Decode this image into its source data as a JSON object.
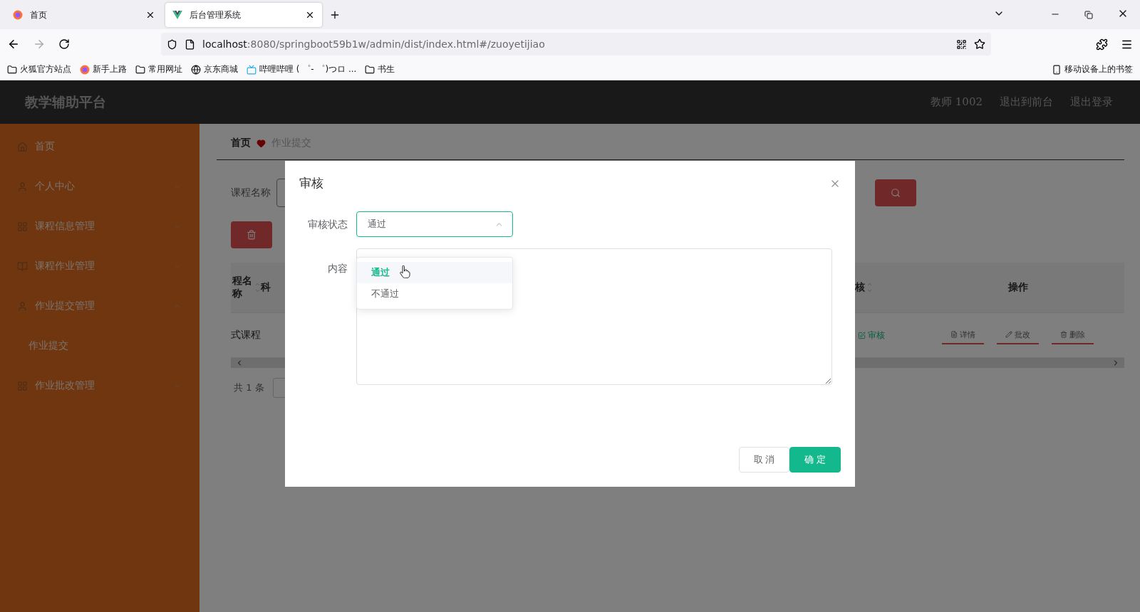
{
  "browser": {
    "tabs": [
      {
        "title": "首页",
        "kind": "firefox",
        "selected": false
      },
      {
        "title": "后台管理系统",
        "kind": "vue",
        "selected": true
      }
    ],
    "address": {
      "host": "localhost",
      "path": ":8080/springboot59b1w/admin/dist/index.html#/zuoyetijiao"
    },
    "bookmarks": [
      {
        "label": "火狐官方站点",
        "kind": "folder"
      },
      {
        "label": "新手上路",
        "kind": "firefox"
      },
      {
        "label": "常用网址",
        "kind": "folder"
      },
      {
        "label": "京东商城",
        "kind": "globe"
      },
      {
        "label": "哔哩哔哩 ( ゜- ゜)つロ ...",
        "kind": "tv"
      },
      {
        "label": "书生",
        "kind": "folder"
      }
    ],
    "mobile_bookmarks": "移动设备上的书签"
  },
  "app": {
    "title": "教学辅助平台",
    "header_links": [
      "教师 1002",
      "退出到前台",
      "退出登录"
    ]
  },
  "sidebar": {
    "items": [
      {
        "label": "首页",
        "kind": "link"
      },
      {
        "label": "个人中心",
        "kind": "menu",
        "expanded": false
      },
      {
        "label": "课程信息管理",
        "kind": "menu",
        "expanded": false
      },
      {
        "label": "课程作业管理",
        "kind": "menu",
        "expanded": false
      },
      {
        "label": "作业提交管理",
        "kind": "menu",
        "expanded": true,
        "children": [
          {
            "label": "作业提交"
          }
        ]
      },
      {
        "label": "作业批改管理",
        "kind": "menu",
        "expanded": false
      }
    ]
  },
  "breadcrumb": {
    "home": "首页",
    "current": "作业提交"
  },
  "search": {
    "label": "课程名称"
  },
  "table": {
    "columns": [
      {
        "label": "程名称",
        "sortable": true
      },
      {
        "label": "科"
      },
      {
        "label": "核",
        "sortable": true
      },
      {
        "label": "操作",
        "sortable": false
      }
    ],
    "rows": [
      {
        "course": "式课程",
        "review": "审核",
        "actions": [
          "详情",
          "批改",
          "删除"
        ]
      }
    ]
  },
  "pagination": {
    "total": "共 1 条"
  },
  "dialog": {
    "title": "审核",
    "status_label": "审核状态",
    "status_value": "通过",
    "open": true,
    "options": [
      {
        "label": "通过",
        "selected": true
      },
      {
        "label": "不通过",
        "selected": false
      }
    ],
    "content_label": "内容",
    "buttons": [
      {
        "label": "取 消",
        "kind": "default"
      },
      {
        "label": "确 定",
        "kind": "primary"
      }
    ]
  }
}
